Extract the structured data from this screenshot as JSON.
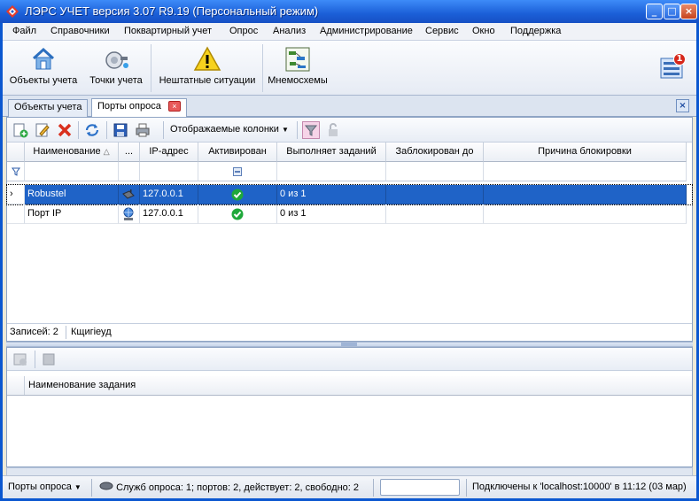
{
  "window": {
    "title": "ЛЭРС УЧЕТ версия 3.07 R9.19 (Персональный режим)"
  },
  "menu": [
    "Файл",
    "Справочники",
    "Поквартирный учет",
    "Опрос",
    "Анализ",
    "Администрирование",
    "Сервис",
    "Окно",
    "Поддержка"
  ],
  "ribbon": {
    "objects": "Объекты учета",
    "points": "Точки учета",
    "emergencies": "Нештатные ситуации",
    "mnemo": "Мнемосхемы",
    "notification_count": "1"
  },
  "tabs": {
    "objects": "Объекты учета",
    "ports": "Порты опроса"
  },
  "toolbar": {
    "columns_label": "Отображаемые колонки"
  },
  "grid": {
    "columns": [
      "Наименование",
      "...",
      "IP-адрес",
      "Активирован",
      "Выполняет заданий",
      "Заблокирован до",
      "Причина блокировки"
    ],
    "rows": [
      {
        "name": "Robustel",
        "ip": "127.0.0.1",
        "tasks": "0 из 1"
      },
      {
        "name": "Порт IP",
        "ip": "127.0.0.1",
        "tasks": "0 из 1"
      }
    ],
    "records": "Записей: 2",
    "filter_text": "Кщигіеуд"
  },
  "lower": {
    "column": "Наименование задания"
  },
  "status": {
    "ports_label": "Порты опроса",
    "services": "Служб опроса: 1; портов: 2, действует: 2, свободно: 2",
    "connection": "Подключены к 'localhost:10000' в 11:12 (03 мар)"
  },
  "colors": {
    "title_bar": "#1b5fd8",
    "selection": "#1f63c7",
    "active_check": "#1fa83a"
  }
}
